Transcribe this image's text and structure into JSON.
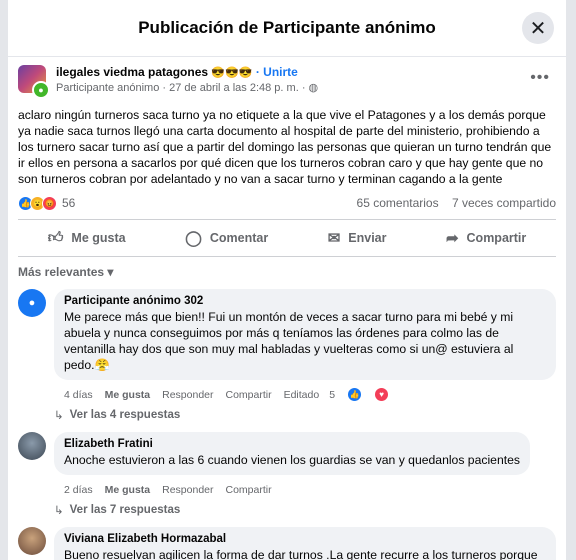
{
  "modal": {
    "title": "Publicación de Participante anónimo"
  },
  "post": {
    "group_name": "ilegales viedma patagones",
    "group_emojis": "😎😎😎",
    "join_label": "· Unirte",
    "author": "Participante anónimo",
    "timestamp": "· 27 de abril a las 2:48 p. m. ·",
    "privacy_icon": "globe-icon",
    "text": "aclaro ningún turneros saca turno ya no etiquete a la que vive el Patagones y a los demás porque ya nadie saca turnos llegó una carta documento al hospital de parte del ministerio, prohibiendo a los turnero sacar turno así que a partir del domingo las personas que quieran un turno tendrán que ir ellos en persona a sacarlos por qué dicen que los turneros cobran caro y que hay gente que no son turneros cobran por adelantado y no van a sacar turno y terminan cagando a la gente",
    "reaction_count": "56",
    "comments_count": "65 comentarios",
    "shares_count": "7 veces compartido"
  },
  "actions": {
    "like": "Me gusta",
    "comment": "Comentar",
    "send": "Enviar",
    "share": "Compartir"
  },
  "sort_label": "Más relevantes",
  "comments": [
    {
      "name": "Participante anónimo 302",
      "text": "Me parece más que bien!! Fui un montón de veces a sacar turno para mi bebé y mi abuela y nunca conseguimos por más q teníamos las órdenes para colmo las de ventanilla hay dos que son muy mal habladas y vuelteras como si un@ estuviera al pedo.😤",
      "time": "4 días",
      "like": "Me gusta",
      "reply": "Responder",
      "share": "Compartir",
      "edited": "Editado",
      "reactions": "5",
      "replies": "Ver las 4 respuestas"
    },
    {
      "name": "Elizabeth Fratini",
      "text": "Anoche estuvieron a las 6 cuando vienen los guardias se van y quedanlos pacientes",
      "time": "2 días",
      "like": "Me gusta",
      "reply": "Responder",
      "share": "Compartir",
      "replies": "Ver las 7 respuestas"
    },
    {
      "name": "Viviana Elizabeth Hormazabal",
      "text": "Bueno resuelvan agilicen la forma de dar turnos .La gente recurre a los turneros porque no puede pasar toda una tarde y la noche para conseguir un turno Basta de pisotearnos"
    }
  ]
}
